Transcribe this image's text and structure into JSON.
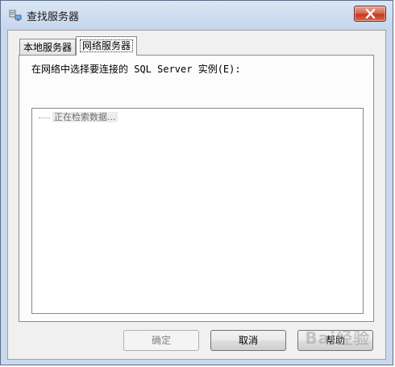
{
  "window": {
    "title": "查找服务器",
    "icon": "server-network-icon",
    "close_icon": "close-icon"
  },
  "tabs": [
    {
      "label": "本地服务器",
      "selected": false
    },
    {
      "label": "网络服务器",
      "selected": true
    }
  ],
  "panel": {
    "prompt": "在网络中选择要连接的 SQL Server 实例(E):",
    "tree_item": "正在检索数据..."
  },
  "buttons": {
    "ok": {
      "label": "确定",
      "enabled": false
    },
    "cancel": {
      "label": "取消",
      "enabled": true
    },
    "help": {
      "label": "帮助",
      "enabled": true
    }
  },
  "watermark": "Bai经验",
  "colors": {
    "close_button": "#c4381f",
    "titlebar": "#c9d8ec"
  }
}
